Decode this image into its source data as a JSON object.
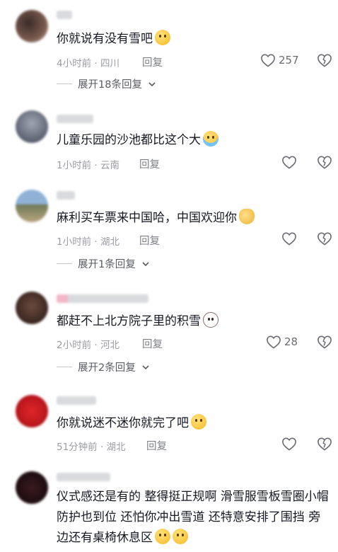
{
  "colors": {
    "text": "#161823",
    "meta": "#9b9ca3",
    "icon": "#6b6c73",
    "background": "#ffffff"
  },
  "comments": [
    {
      "text": "你就说有没有雪吧",
      "emoji": "grin-emoji",
      "time_location": "4小时前 · 四川",
      "reply_label": "回复",
      "likes": "257",
      "expand_label": "展开18条回复"
    },
    {
      "text": "儿童乐园的沙池都比这个大",
      "emoji": "laugh-cry-emoji",
      "time_location": "1小时前 · 云南",
      "reply_label": "回复",
      "likes": ""
    },
    {
      "text": "麻利买车票来中国哈，中国欢迎你",
      "emoji": "money-bag-emoji",
      "time_location": "1小时前 · 湖北",
      "reply_label": "回复",
      "likes": "",
      "expand_label": "展开1条回复"
    },
    {
      "text": "都赶不上北方院子里的积雪",
      "emoji": "cat-emoji",
      "time_location": "2小时前 · 河北",
      "reply_label": "回复",
      "likes": "28",
      "expand_label": "展开2条回复"
    },
    {
      "text": "你就说迷不迷你就完了吧",
      "emoji": "grin-emoji",
      "time_location": "51分钟前 · 湖北",
      "reply_label": "回复",
      "likes": ""
    },
    {
      "text": "仪式感还是有的  整得挺正规啊  滑雪服雪板雪圈小帽  防护也到位  还怕你冲出雪道  还特意安排了围挡  旁边还有桌椅休息区",
      "emoji": "grin-emoji"
    }
  ]
}
